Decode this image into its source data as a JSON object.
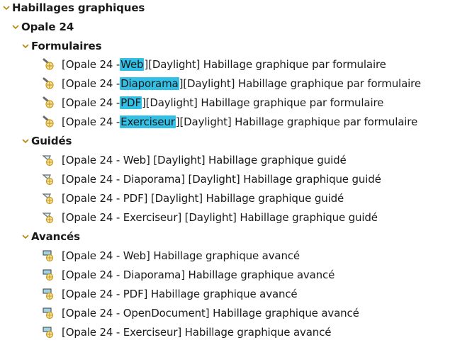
{
  "root": {
    "label": "Habillages graphiques"
  },
  "opale": {
    "label": "Opale 24"
  },
  "formulaires": {
    "label": "Formulaires",
    "items": [
      {
        "prefix": "[Opale 24 - ",
        "highlight": " Web",
        "mid": "] ",
        "suffix": "[Daylight] Habillage graphique par formulaire",
        "icon": "form-skin-icon"
      },
      {
        "prefix": "[Opale 24 - ",
        "highlight": "Diaporama",
        "mid": "] ",
        "suffix": "[Daylight] Habillage graphique par formulaire",
        "icon": "form-skin-icon"
      },
      {
        "prefix": "[Opale 24 - ",
        "highlight": "PDF",
        "mid": "] ",
        "suffix": "[Daylight] Habillage graphique par formulaire",
        "icon": "form-skin-icon"
      },
      {
        "prefix": "[Opale 24 - ",
        "highlight": "Exerciseur",
        "mid": "] ",
        "suffix": "[Daylight] Habillage graphique par formulaire",
        "icon": "form-skin-icon"
      }
    ]
  },
  "guides": {
    "label": "Guidés",
    "items": [
      {
        "text": "[Opale 24 - Web] [Daylight] Habillage graphique guidé",
        "icon": "guided-skin-icon"
      },
      {
        "text": "[Opale 24 - Diaporama] [Daylight] Habillage graphique guidé",
        "icon": "guided-skin-icon"
      },
      {
        "text": "[Opale 24 - PDF] [Daylight] Habillage graphique guidé",
        "icon": "guided-skin-icon"
      },
      {
        "text": "[Opale 24 - Exerciseur] [Daylight] Habillage graphique guidé",
        "icon": "guided-skin-icon"
      }
    ]
  },
  "avances": {
    "label": "Avancés",
    "items": [
      {
        "text": "[Opale 24 - Web] Habillage graphique avancé",
        "icon": "advanced-skin-icon"
      },
      {
        "text": "[Opale 24 - Diaporama] Habillage graphique avancé",
        "icon": "advanced-skin-icon"
      },
      {
        "text": "[Opale 24 - PDF] Habillage graphique avancé",
        "icon": "advanced-skin-icon"
      },
      {
        "text": "[Opale 24 - OpenDocument] Habillage graphique avancé",
        "icon": "advanced-skin-icon"
      },
      {
        "text": "[Opale 24 - Exerciseur] Habillage graphique avancé",
        "icon": "advanced-skin-icon"
      }
    ]
  },
  "colors": {
    "highlight": "#33c0e6",
    "chevron": "#b8860b"
  }
}
